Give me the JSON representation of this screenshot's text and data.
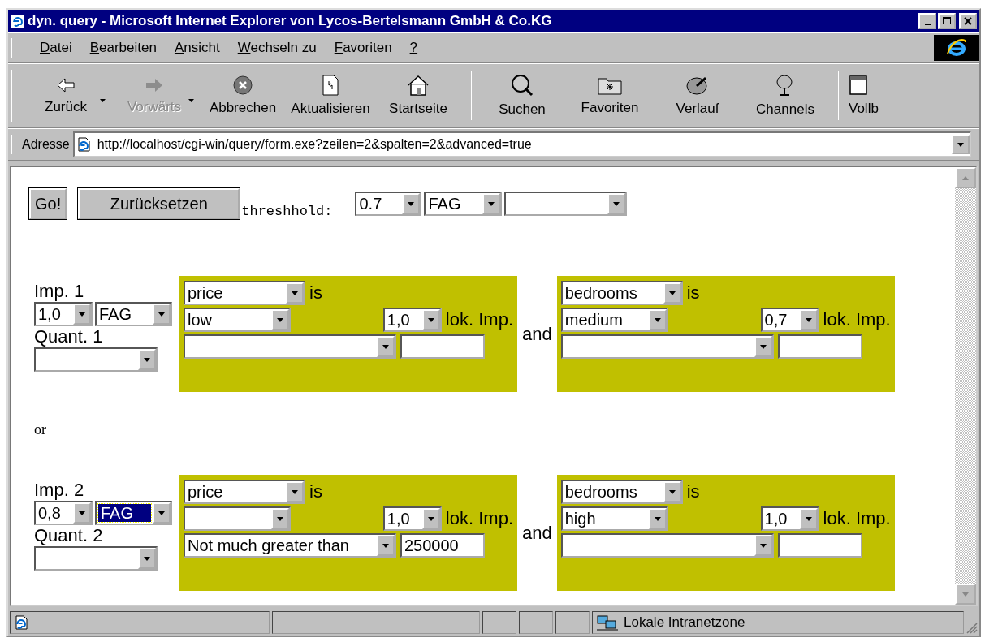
{
  "window": {
    "title": "dyn. query - Microsoft Internet Explorer von Lycos-Bertelsmann GmbH & Co.KG"
  },
  "menu": [
    {
      "accel": "D",
      "rest": "atei"
    },
    {
      "accel": "B",
      "rest": "earbeiten"
    },
    {
      "accel": "A",
      "rest": "nsicht"
    },
    {
      "accel": "W",
      "rest": "echseln zu"
    },
    {
      "accel": "F",
      "rest": "avoriten"
    },
    {
      "accel": "?"
    }
  ],
  "toolbar": [
    {
      "kind": "back",
      "label": "Zurück",
      "disabled": false,
      "dropdown": true
    },
    {
      "kind": "forward",
      "label": "Vorwärts",
      "disabled": true,
      "dropdown": true
    },
    {
      "kind": "stop",
      "label": "Abbrechen",
      "disabled": false,
      "dropdown": false
    },
    {
      "kind": "refresh",
      "label": "Aktualisieren",
      "disabled": false,
      "dropdown": false
    },
    {
      "kind": "home",
      "label": "Startseite",
      "disabled": false,
      "dropdown": false
    },
    {
      "kind": "separator"
    },
    {
      "kind": "search",
      "label": "Suchen",
      "disabled": false,
      "dropdown": false
    },
    {
      "kind": "favorites",
      "label": "Favoriten",
      "disabled": false,
      "dropdown": false
    },
    {
      "kind": "history",
      "label": "Verlauf",
      "disabled": false,
      "dropdown": false
    },
    {
      "kind": "channels",
      "label": "Channels",
      "disabled": false,
      "dropdown": false
    },
    {
      "kind": "separator"
    },
    {
      "kind": "fullscreen",
      "label": "Vollb",
      "disabled": false,
      "dropdown": false
    }
  ],
  "address": {
    "label": "Adresse",
    "url": "http://localhost/cgi-win/query/form.exe?zeilen=2&spalten=2&advanced=true"
  },
  "form": {
    "buttons": [
      {
        "label": "Go!",
        "kind": "submit"
      },
      {
        "label": "Zurücksetzen",
        "kind": "reset"
      }
    ],
    "threshold_label": "threshhold:",
    "threshold_selects": [
      {
        "value": "0.7",
        "focused": false
      },
      {
        "value": "FAG",
        "focused": false
      },
      {
        "focused": false
      }
    ],
    "separator": "or",
    "groups": [
      {
        "imp_label": "Imp. 1",
        "imp": {
          "value": "1,0",
          "focused": false
        },
        "agg": {
          "value": "FAG",
          "focused": false
        },
        "quant_label": "Quant. 1",
        "quant": {
          "focused": false
        },
        "connector": "and",
        "conditions": [
          {
            "attribute": {
              "value": "price",
              "focused": false
            },
            "is_label": "is",
            "term": {
              "value": "low",
              "focused": false
            },
            "lok": {
              "value": "1,0",
              "focused": false
            },
            "lok_label": "lok. Imp.",
            "modifier": {
              "focused": false
            }
          },
          {
            "attribute": {
              "value": "bedrooms",
              "focused": false
            },
            "is_label": "is",
            "term": {
              "value": "medium",
              "focused": false
            },
            "lok": {
              "value": "0,7",
              "focused": false
            },
            "lok_label": "lok. Imp.",
            "modifier": {
              "focused": false
            }
          }
        ]
      },
      {
        "imp_label": "Imp. 2",
        "imp": {
          "value": "0,8",
          "focused": false
        },
        "agg": {
          "value": "FAG",
          "focused": true
        },
        "quant_label": "Quant. 2",
        "quant": {
          "focused": false
        },
        "connector": "and",
        "conditions": [
          {
            "attribute": {
              "value": "price",
              "focused": false
            },
            "is_label": "is",
            "term": {
              "focused": false
            },
            "lok": {
              "value": "1,0",
              "focused": false
            },
            "lok_label": "lok. Imp.",
            "modifier": {
              "value": "Not much greater than",
              "focused": false
            },
            "modifier_value": "250000"
          },
          {
            "attribute": {
              "value": "bedrooms",
              "focused": false
            },
            "is_label": "is",
            "term": {
              "value": "high",
              "focused": false
            },
            "lok": {
              "value": "1,0",
              "focused": false
            },
            "lok_label": "lok. Imp.",
            "modifier": {
              "focused": false
            }
          }
        ]
      }
    ]
  },
  "status_bar": {
    "zone": "Lokale Intranetzone"
  }
}
